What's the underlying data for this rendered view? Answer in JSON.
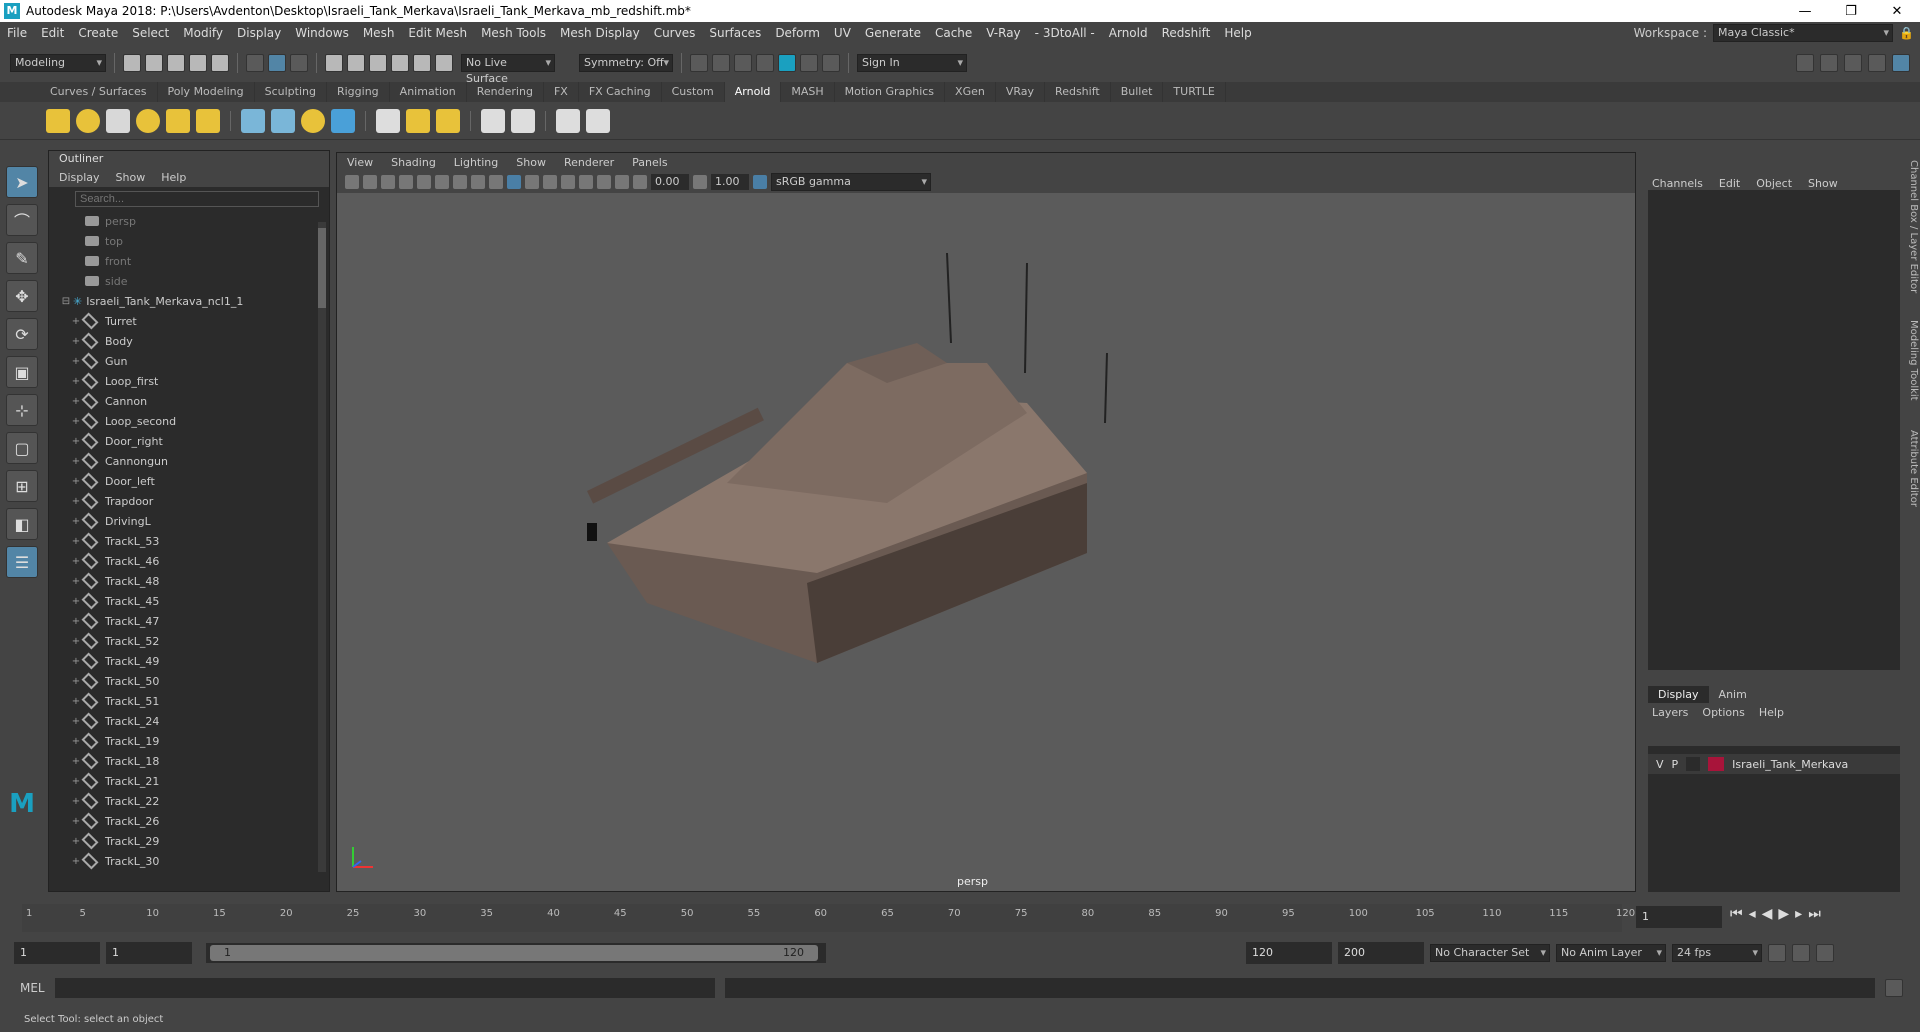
{
  "window": {
    "title": "Autodesk Maya 2018: P:\\Users\\Avdenton\\Desktop\\Israeli_Tank_Merkava\\Israeli_Tank_Merkava_mb_redshift.mb*",
    "minimize": "—",
    "maximize": "❐",
    "close": "✕"
  },
  "menubar": {
    "items": [
      "File",
      "Edit",
      "Create",
      "Select",
      "Modify",
      "Display",
      "Windows",
      "Mesh",
      "Edit Mesh",
      "Mesh Tools",
      "Mesh Display",
      "Curves",
      "Surfaces",
      "Deform",
      "UV",
      "Generate",
      "Cache",
      "V-Ray",
      "- 3DtoAll -",
      "Arnold",
      "Redshift",
      "Help"
    ],
    "workspace_label": "Workspace :",
    "workspace_value": "Maya Classic*"
  },
  "statusline": {
    "mode": "Modeling",
    "live_surface": "No Live Surface",
    "symmetry": "Symmetry: Off",
    "sign_in": "Sign In"
  },
  "shelf": {
    "tabs": [
      "Curves / Surfaces",
      "Poly Modeling",
      "Sculpting",
      "Rigging",
      "Animation",
      "Rendering",
      "FX",
      "FX Caching",
      "Custom",
      "Arnold",
      "MASH",
      "Motion Graphics",
      "XGen",
      "VRay",
      "Redshift",
      "Bullet",
      "TURTLE"
    ],
    "active": "Arnold"
  },
  "outliner": {
    "title": "Outliner",
    "menu": [
      "Display",
      "Show",
      "Help"
    ],
    "search_placeholder": "Search...",
    "cameras": [
      "persp",
      "top",
      "front",
      "side"
    ],
    "group": "Israeli_Tank_Merkava_ncl1_1",
    "items": [
      "Turret",
      "Body",
      "Gun",
      "Loop_first",
      "Cannon",
      "Loop_second",
      "Door_right",
      "Cannongun",
      "Door_left",
      "Trapdoor",
      "DrivingL",
      "TrackL_53",
      "TrackL_46",
      "TrackL_48",
      "TrackL_45",
      "TrackL_47",
      "TrackL_52",
      "TrackL_49",
      "TrackL_50",
      "TrackL_51",
      "TrackL_24",
      "TrackL_19",
      "TrackL_18",
      "TrackL_21",
      "TrackL_22",
      "TrackL_26",
      "TrackL_29",
      "TrackL_30"
    ]
  },
  "viewport": {
    "menu": [
      "View",
      "Shading",
      "Lighting",
      "Show",
      "Renderer",
      "Panels"
    ],
    "exposure": "0.00",
    "gamma": "1.00",
    "colorspace": "sRGB gamma",
    "camera": "persp"
  },
  "channelbox": {
    "menu": [
      "Channels",
      "Edit",
      "Object",
      "Show"
    ],
    "side_tabs": [
      "Channel Box / Layer Editor",
      "Modeling Toolkit",
      "Attribute Editor"
    ]
  },
  "layers": {
    "tabs": [
      "Display",
      "Anim"
    ],
    "menu": [
      "Layers",
      "Options",
      "Help"
    ],
    "row": {
      "v": "V",
      "p": "P",
      "name": "Israeli_Tank_Merkava",
      "color": "#a8143a"
    }
  },
  "timeline": {
    "ticks": [
      "1",
      "5",
      "10",
      "15",
      "20",
      "25",
      "30",
      "35",
      "40",
      "45",
      "50",
      "55",
      "60",
      "65",
      "70",
      "75",
      "80",
      "85",
      "90",
      "95",
      "100",
      "105",
      "110",
      "115",
      "120"
    ],
    "current": "1"
  },
  "range": {
    "start": "1",
    "start2": "1",
    "slider_start": "1",
    "slider_end": "120",
    "end": "120",
    "end2": "200",
    "character_set": "No Character Set",
    "anim_layer": "No Anim Layer",
    "fps": "24 fps"
  },
  "cmd": {
    "label": "MEL"
  },
  "help": {
    "text": "Select Tool: select an object"
  }
}
